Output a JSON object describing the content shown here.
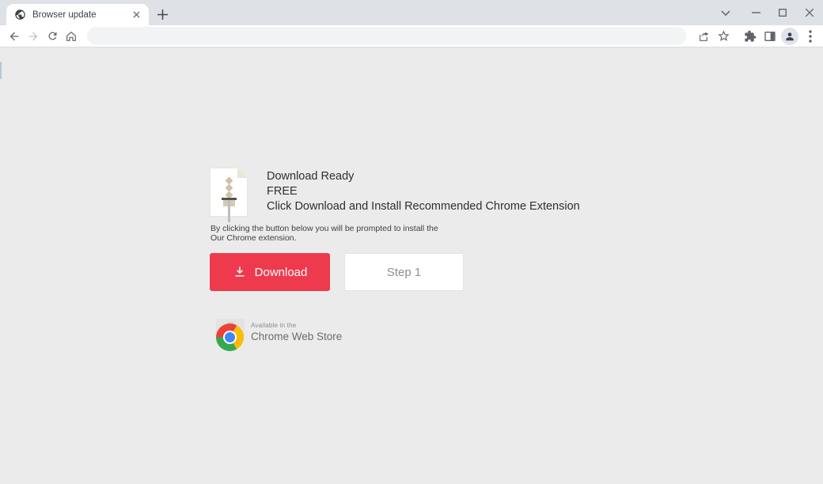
{
  "window": {
    "tab": {
      "title": "Browser update"
    },
    "controls": {
      "tab_search": "tab-search-chevron",
      "minimize": "minimize",
      "maximize": "maximize",
      "close": "close"
    }
  },
  "toolbar": {
    "address_bar": {
      "value": "",
      "placeholder": ""
    }
  },
  "content": {
    "heading_line1": "Download Ready",
    "heading_line2": "FREE",
    "heading_line3": "Click Download and Install Recommended Chrome Extension",
    "note_line1": "By clicking the button below you will be prompted to install the",
    "note_line2": "Our Chrome extension.",
    "download_button_label": "Download",
    "step_button_label": "Step 1",
    "badge": {
      "tagline": "Available in the",
      "store_name": "Chrome Web Store"
    }
  },
  "icons": {
    "favicon": "globe-icon",
    "nav": [
      "back-icon",
      "forward-icon",
      "reload-icon",
      "home-icon"
    ],
    "right": [
      "share-icon",
      "bookmark-star-icon",
      "extensions-puzzle-icon",
      "side-panel-icon",
      "profile-icon",
      "kebab-menu-icon"
    ],
    "button": "download-arrow-icon"
  },
  "colors": {
    "accent_red": "#ee3a4d",
    "tabstrip_bg": "#dee1e6",
    "toolbar_bg": "#ffffff",
    "page_bg": "#ebebeb",
    "chrome_red": "#ea4335",
    "chrome_yellow": "#fbbc05",
    "chrome_green": "#34a853",
    "chrome_blue": "#4285f4"
  }
}
